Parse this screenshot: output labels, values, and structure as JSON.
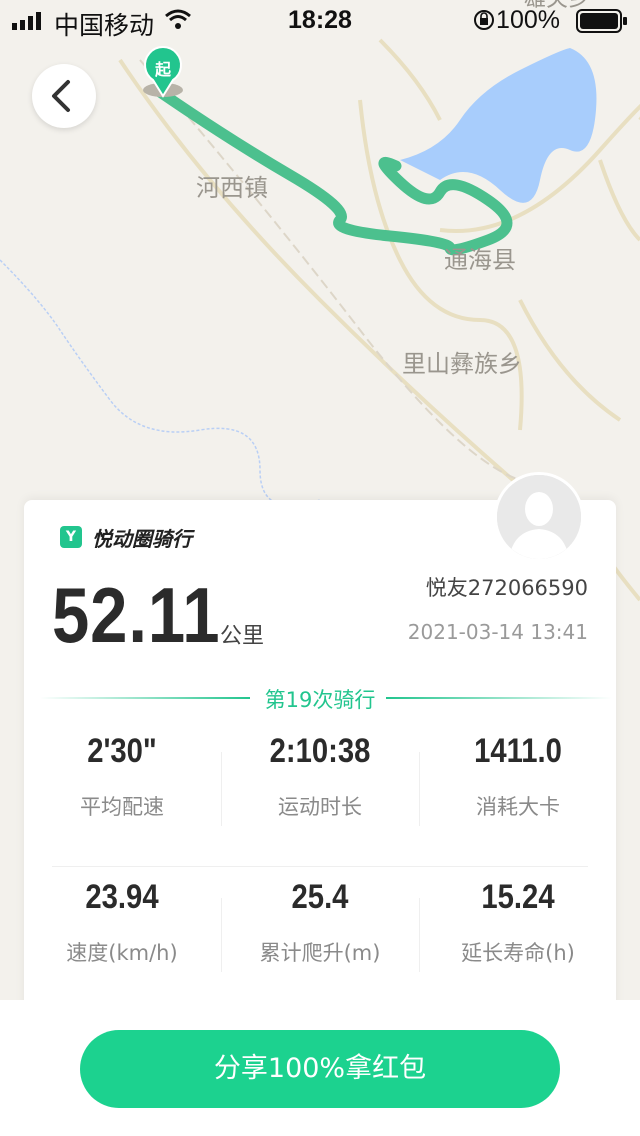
{
  "status_bar": {
    "carrier": "中国移动",
    "time": "18:28",
    "battery": "100%"
  },
  "map": {
    "places": {
      "hexi": "河西镇",
      "tonghai": "通海县",
      "lishan": "里山彝族乡",
      "top_right": "雄关乡"
    },
    "start_marker": "起",
    "colors": {
      "route": "#4cc08e",
      "lake": "#a8cdfc",
      "road": "#e8dfc1"
    }
  },
  "card": {
    "brand": "悦动圈骑行",
    "brand_logo": "Y",
    "distance": "52.11",
    "distance_unit": "公里",
    "username": "悦友272066590",
    "datetime": "2021-03-14 13:41",
    "ride_count": "第19次骑行",
    "stats": [
      {
        "value": "2'30\"",
        "label": "平均配速"
      },
      {
        "value": "2:10:38",
        "label": "运动时长"
      },
      {
        "value": "1411.0",
        "label": "消耗大卡"
      },
      {
        "value": "23.94",
        "label": "速度(km/h)"
      },
      {
        "value": "25.4",
        "label": "累计爬升(m)"
      },
      {
        "value": "15.24",
        "label": "延长寿命(h)"
      }
    ]
  },
  "share_button": "分享100%拿红包",
  "accent_color": "#1cd28f"
}
